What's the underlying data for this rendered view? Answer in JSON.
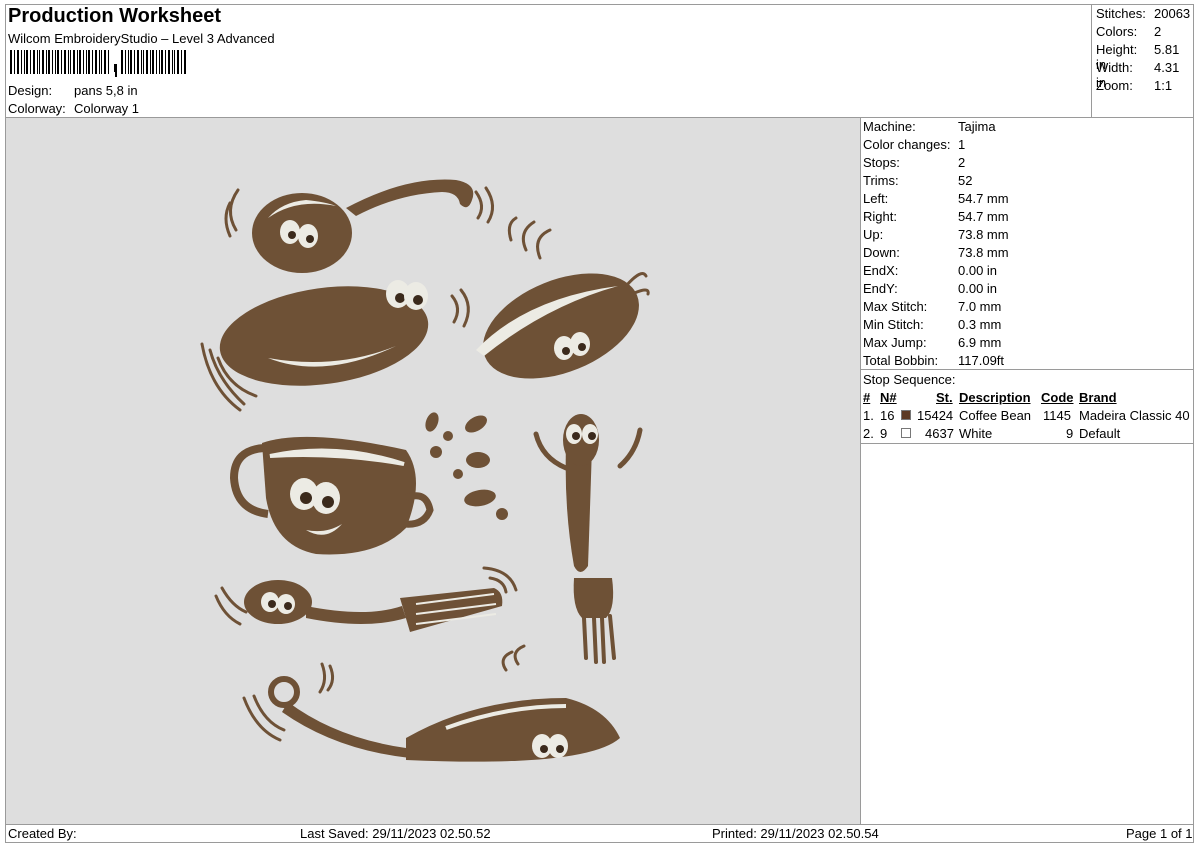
{
  "header": {
    "title": "Production Worksheet",
    "subtitle": "Wilcom EmbroideryStudio – Level 3 Advanced",
    "design_label": "Design:",
    "design_value": "pans 5,8 in",
    "colorway_label": "Colorway:",
    "colorway_value": "Colorway 1"
  },
  "summary": [
    {
      "label": "Stitches:",
      "value": "20063"
    },
    {
      "label": "Colors:",
      "value": "2"
    },
    {
      "label": "Height:",
      "value": "5.81 in"
    },
    {
      "label": "Width:",
      "value": "4.31 in"
    },
    {
      "label": "Zoom:",
      "value": "1:1"
    }
  ],
  "properties": [
    {
      "label": "Machine:",
      "value": "Tajima"
    },
    {
      "label": "Color changes:",
      "value": "1"
    },
    {
      "label": "Stops:",
      "value": "2"
    },
    {
      "label": "Trims:",
      "value": "52"
    },
    {
      "label": "Left:",
      "value": "54.7 mm"
    },
    {
      "label": "Right:",
      "value": "54.7 mm"
    },
    {
      "label": "Up:",
      "value": "73.8 mm"
    },
    {
      "label": "Down:",
      "value": "73.8 mm"
    },
    {
      "label": "EndX:",
      "value": "0.00 in"
    },
    {
      "label": "EndY:",
      "value": "0.00 in"
    },
    {
      "label": "Max Stitch:",
      "value": "7.0 mm"
    },
    {
      "label": "Min Stitch:",
      "value": "0.3 mm"
    },
    {
      "label": "Max Jump:",
      "value": "6.9 mm"
    },
    {
      "label": "Total Bobbin:",
      "value": "117.09ft"
    }
  ],
  "stop_sequence": {
    "title": "Stop Sequence:",
    "headers": {
      "num": "#",
      "n": "N#",
      "st": "St.",
      "description": "Description",
      "code": "Code",
      "brand": "Brand"
    },
    "rows": [
      {
        "num": "1.",
        "n": "16",
        "color": "#5c3a24",
        "st": "15424",
        "description": "Coffee Bean",
        "code": "1145",
        "brand": "Madeira Classic 40"
      },
      {
        "num": "2.",
        "n": "9",
        "color": "#ffffff",
        "st": "4637",
        "description": "White",
        "code": "9",
        "brand": "Default"
      }
    ]
  },
  "footer": {
    "created_by": "Created By:",
    "last_saved": "Last Saved: 29/11/2023 02.50.52",
    "printed": "Printed: 29/11/2023 02.50.54",
    "page": "Page 1 of 1"
  },
  "colors": {
    "thread_brown": "#6e5136",
    "thread_white": "#ecebe4",
    "design_background": "#dedede"
  },
  "design_items": [
    "spoon-character",
    "plate-character",
    "pan-character",
    "cup-character",
    "fork-character",
    "spatula-character",
    "skillet-character"
  ]
}
